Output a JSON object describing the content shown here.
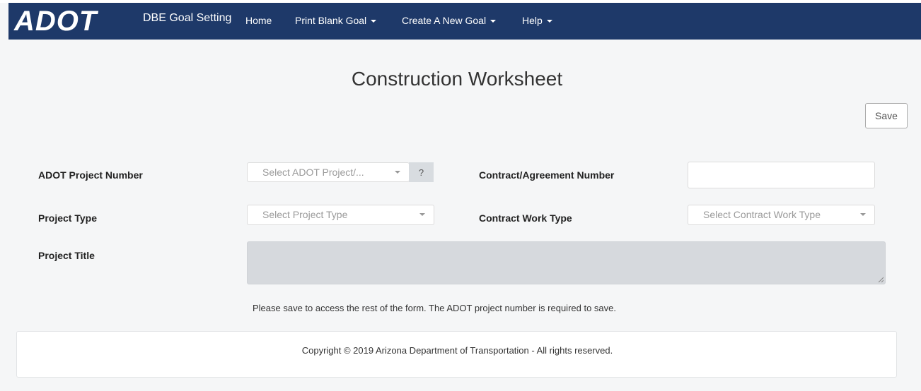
{
  "header": {
    "logo_text": "ADOT",
    "brand": "DBE Goal Setting",
    "nav": [
      {
        "label": "Home"
      },
      {
        "label": "Print Blank Goal"
      },
      {
        "label": "Create A New Goal"
      },
      {
        "label": "Help"
      }
    ]
  },
  "page": {
    "title": "Construction Worksheet",
    "save_label": "Save"
  },
  "form": {
    "project_number_label": "ADOT Project Number",
    "project_number_placeholder": "Select ADOT Project/...",
    "help_label": "?",
    "contract_number_label": "Contract/Agreement Number",
    "contract_number_value": "",
    "project_type_label": "Project Type",
    "project_type_placeholder": "Select Project Type",
    "contract_work_type_label": "Contract Work Type",
    "contract_work_type_placeholder": "Select Contract Work Type",
    "project_title_label": "Project Title",
    "project_title_value": ""
  },
  "message": "Please save to access the rest of the form. The ADOT project number is required to save.",
  "footer": {
    "copyright": "Copyright © 2019 Arizona Department of Transportation - All rights reserved."
  },
  "colors": {
    "navbar": "#1e3969",
    "background": "#f5f6f7",
    "disabled_field": "#d6d9dd"
  }
}
